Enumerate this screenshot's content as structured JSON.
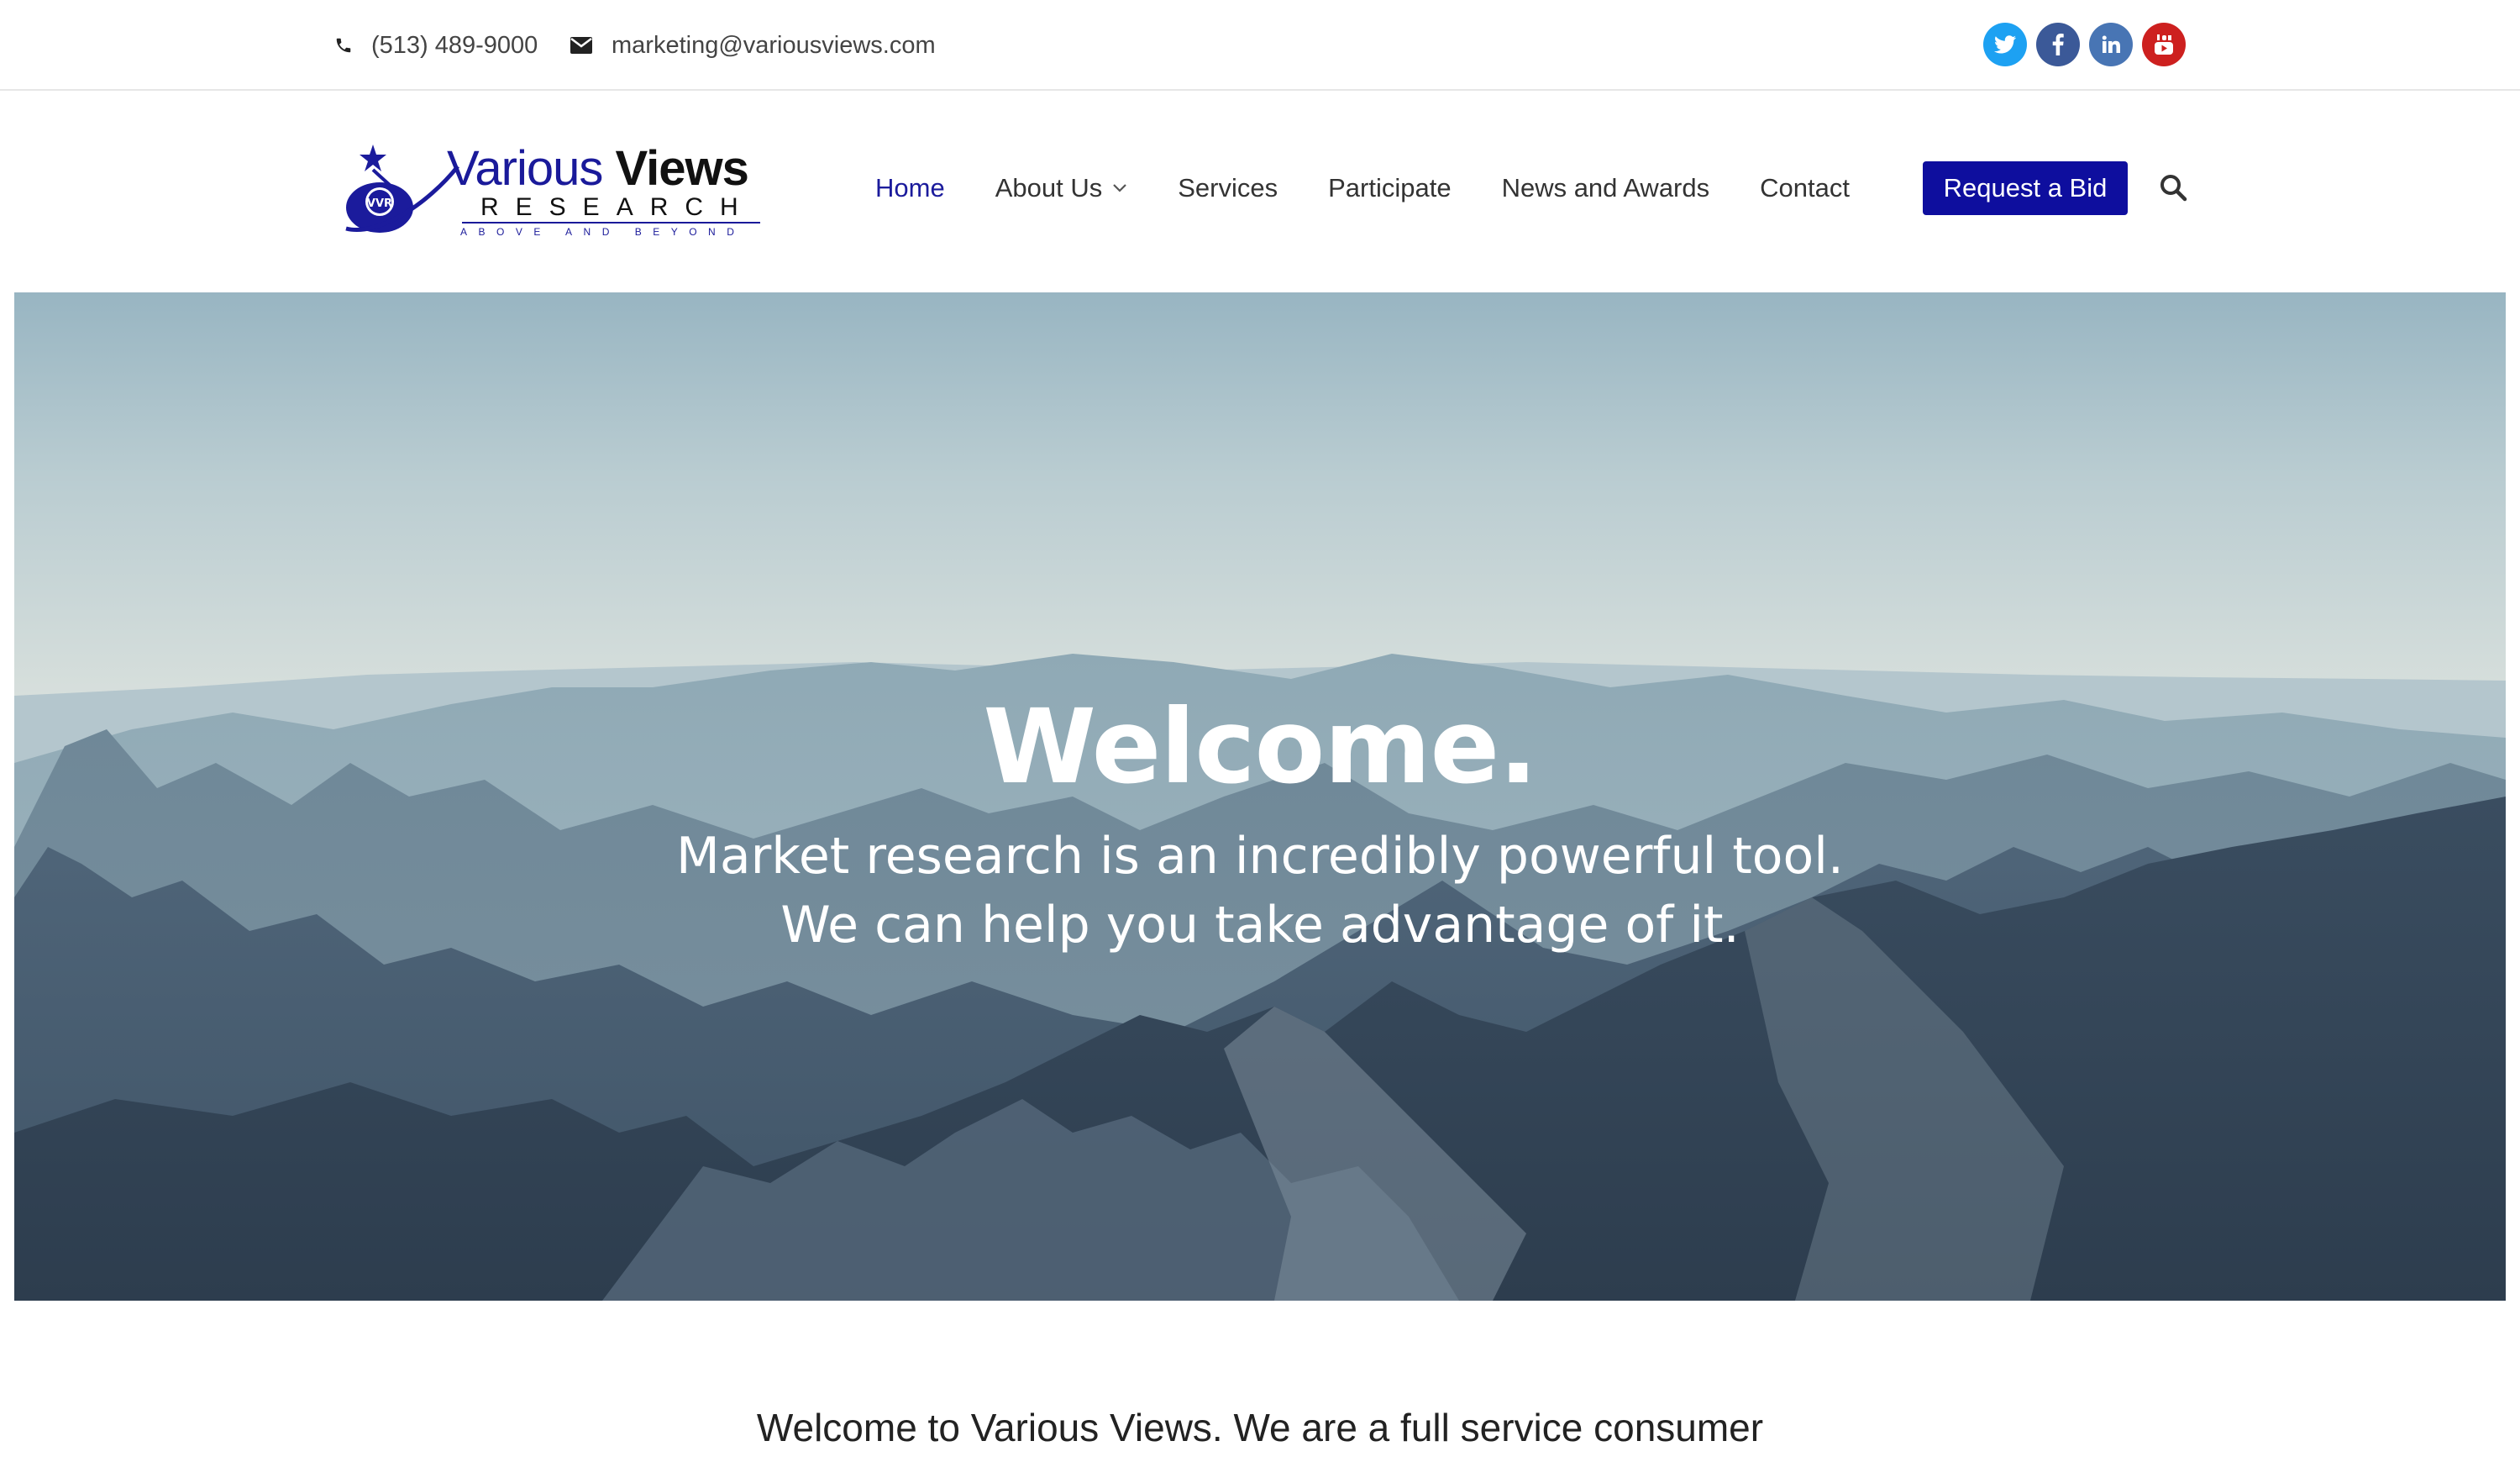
{
  "topbar": {
    "phone": "(513) 489-9000",
    "email": "marketing@variousviews.com",
    "social": [
      {
        "icon": "twitter-icon",
        "glyph": "t",
        "color": "#1da1f2"
      },
      {
        "icon": "facebook-icon",
        "glyph": "f",
        "color": "#3b5998"
      },
      {
        "icon": "linkedin-icon",
        "glyph": "in",
        "color": "#4875b4"
      },
      {
        "icon": "youtube-icon",
        "glyph": "▶",
        "color": "#cd201f"
      }
    ]
  },
  "logo": {
    "word1": "Various ",
    "word2": "Views",
    "research": "RESEARCH",
    "tagline": "ABOVE AND BEYOND",
    "badge": "VVR"
  },
  "nav": {
    "items": [
      "Home",
      "About Us",
      "Services",
      "Participate",
      "News and Awards",
      "Contact"
    ],
    "active_index": 0,
    "cta": "Request a Bid"
  },
  "hero": {
    "title": "Welcome.",
    "line1": "Market research is an incredibly powerful tool.",
    "line2": "We can help you take advantage of it."
  },
  "intro": {
    "text": "Welcome to Various Views. We are a full service consumer"
  },
  "colors": {
    "brand_blue": "#1b1b9c",
    "cta_bg": "#0e0e9e"
  }
}
